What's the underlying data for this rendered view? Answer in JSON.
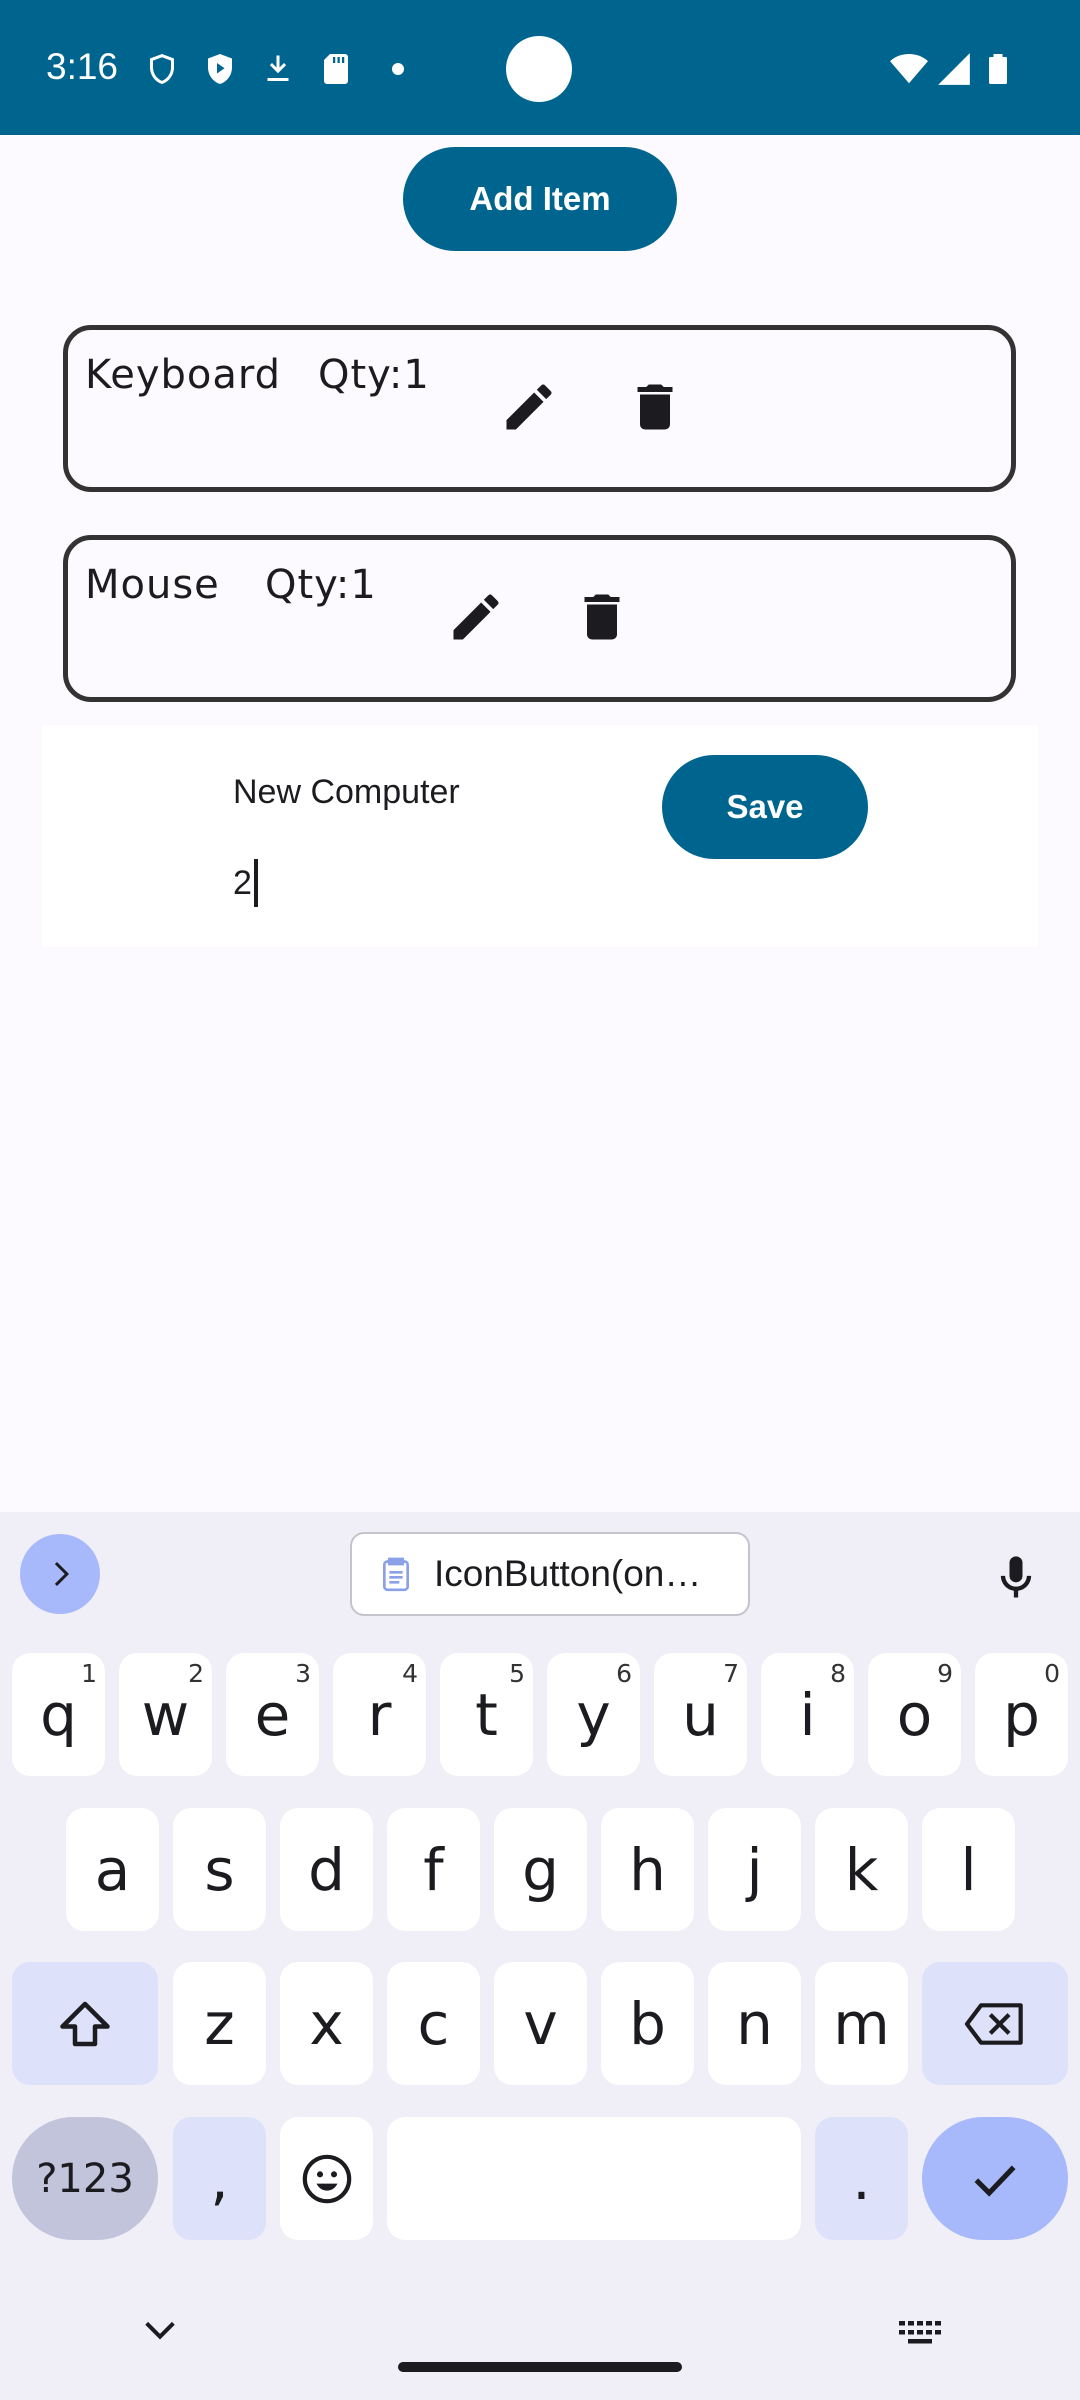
{
  "status_bar": {
    "time": "3:16",
    "left_icons": [
      "shield-outline-icon",
      "shield-play-icon",
      "download-icon",
      "sd-card-icon",
      "dot-icon"
    ],
    "right_icons": [
      "wifi-icon",
      "cell-signal-icon",
      "battery-icon"
    ],
    "color": "#00658e"
  },
  "main": {
    "add_item_label": "Add Item",
    "items": [
      {
        "name": "Keyboard",
        "qty": "Qty:1"
      },
      {
        "name": "Mouse",
        "qty": "Qty:1"
      }
    ],
    "edit_panel": {
      "name_value": "New Computer",
      "qty_value": "2",
      "save_label": "Save"
    },
    "accent": "#00658e"
  },
  "keyboard": {
    "clipboard_suggestion": "IconButton(on…",
    "row1": [
      {
        "label": "q",
        "hint": "1"
      },
      {
        "label": "w",
        "hint": "2"
      },
      {
        "label": "e",
        "hint": "3"
      },
      {
        "label": "r",
        "hint": "4"
      },
      {
        "label": "t",
        "hint": "5"
      },
      {
        "label": "y",
        "hint": "6"
      },
      {
        "label": "u",
        "hint": "7"
      },
      {
        "label": "i",
        "hint": "8"
      },
      {
        "label": "o",
        "hint": "9"
      },
      {
        "label": "p",
        "hint": "0"
      }
    ],
    "row2": [
      "a",
      "s",
      "d",
      "f",
      "g",
      "h",
      "j",
      "k",
      "l"
    ],
    "row3": [
      "z",
      "x",
      "c",
      "v",
      "b",
      "n",
      "m"
    ],
    "symbols_label": "?123",
    "comma_label": ",",
    "period_label": "."
  }
}
